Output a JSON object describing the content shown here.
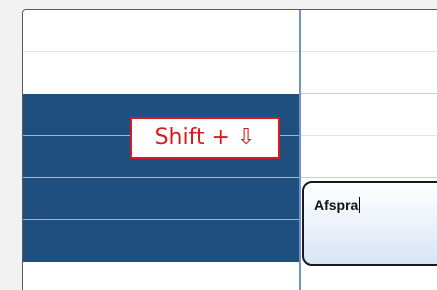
{
  "app": {
    "view": "calendar-day-view"
  },
  "shortcut_callout": {
    "text": "Shift + ⇩"
  },
  "appointment": {
    "subject": "Afspra"
  },
  "colors": {
    "selection": "#1e4f7e",
    "divider": "#6f93c6",
    "callout_border": "#d8191f"
  }
}
